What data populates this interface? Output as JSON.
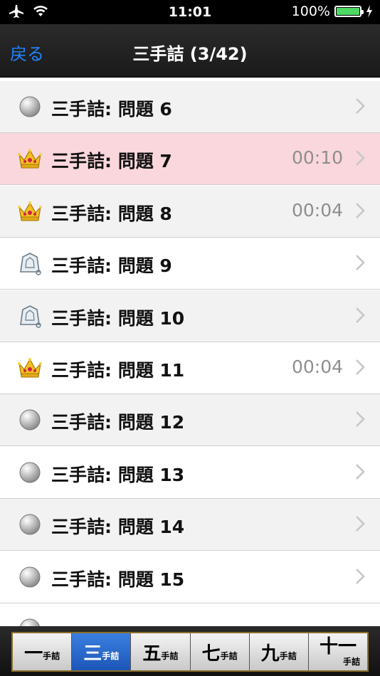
{
  "status_bar": {
    "time": "11:01",
    "battery_percent": "100%",
    "icons": [
      "airplane-icon",
      "wifi-icon",
      "battery-icon",
      "charging-icon"
    ]
  },
  "nav": {
    "back_label": "戻る",
    "title": "三手詰 (3/42)"
  },
  "rows": [
    {
      "title": "三手詰: 問題  6",
      "time": "",
      "icon": "unsolved-circle-icon"
    },
    {
      "title": "三手詰: 問題  7",
      "time": "00:10",
      "icon": "crown-icon"
    },
    {
      "title": "三手詰: 問題  8",
      "time": "00:04",
      "icon": "crown-icon"
    },
    {
      "title": "三手詰: 問題  9",
      "time": "",
      "icon": "shogi-piece-icon"
    },
    {
      "title": "三手詰: 問題 10",
      "time": "",
      "icon": "shogi-piece-icon"
    },
    {
      "title": "三手詰: 問題 11",
      "time": "00:04",
      "icon": "crown-icon"
    },
    {
      "title": "三手詰: 問題 12",
      "time": "",
      "icon": "unsolved-circle-icon"
    },
    {
      "title": "三手詰: 問題 13",
      "time": "",
      "icon": "unsolved-circle-icon"
    },
    {
      "title": "三手詰: 問題 14",
      "time": "",
      "icon": "unsolved-circle-icon"
    },
    {
      "title": "三手詰: 問題 15",
      "time": "",
      "icon": "unsolved-circle-icon"
    }
  ],
  "tabs": [
    {
      "big": "一",
      "small": "手詰"
    },
    {
      "big": "三",
      "small": "手詰"
    },
    {
      "big": "五",
      "small": "手詰"
    },
    {
      "big": "七",
      "small": "手詰"
    },
    {
      "big": "九",
      "small": "手詰"
    },
    {
      "big": "十一",
      "small": "手詰"
    }
  ],
  "colors": {
    "selected_row": "#fad7dc",
    "accent_blue": "#1e86ff",
    "active_tab": "#1d56b8"
  }
}
